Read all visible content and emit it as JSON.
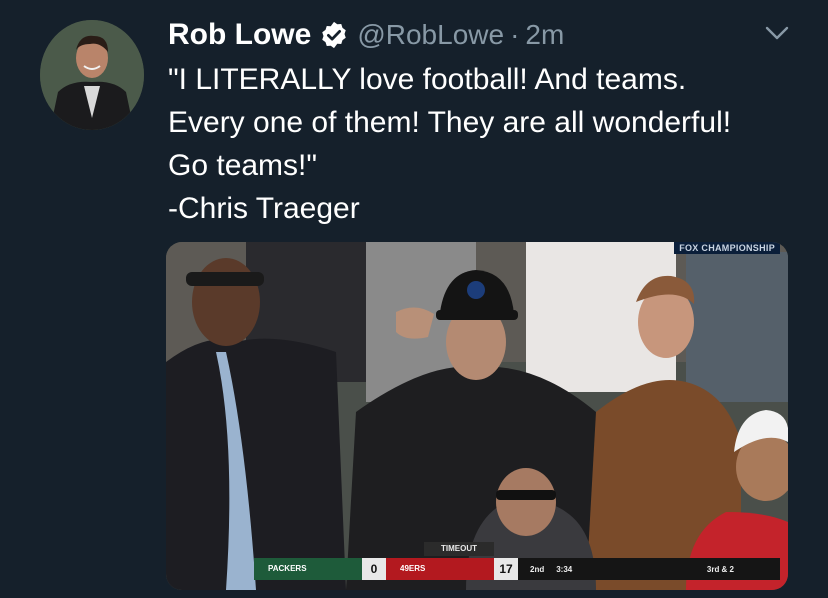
{
  "tweet": {
    "display_name": "Rob Lowe",
    "handle": "@RobLowe",
    "separator": "·",
    "time": "2m",
    "text_lines": [
      "\"I LITERALLY love football! And teams.",
      "Every one of them! They are all wonderful!",
      "Go teams!\"",
      "-Chris Traeger"
    ]
  },
  "icons": {
    "verified": "verified-badge-icon",
    "menu": "chevron-down-icon"
  },
  "media": {
    "broadcast_bug": "FOX CHAMPIONSHIP",
    "scorebug": {
      "timeout_label": "TIMEOUT",
      "home_team": "PACKERS",
      "home_score": "0",
      "away_team": "49ERS",
      "away_score": "17",
      "quarter": "2nd",
      "clock": "3:34",
      "down_distance": "3rd & 2"
    }
  },
  "colors": {
    "background": "#15202b",
    "secondary_text": "#8899a6",
    "packers_green": "#1e5b3a",
    "niners_red": "#b3191f"
  }
}
